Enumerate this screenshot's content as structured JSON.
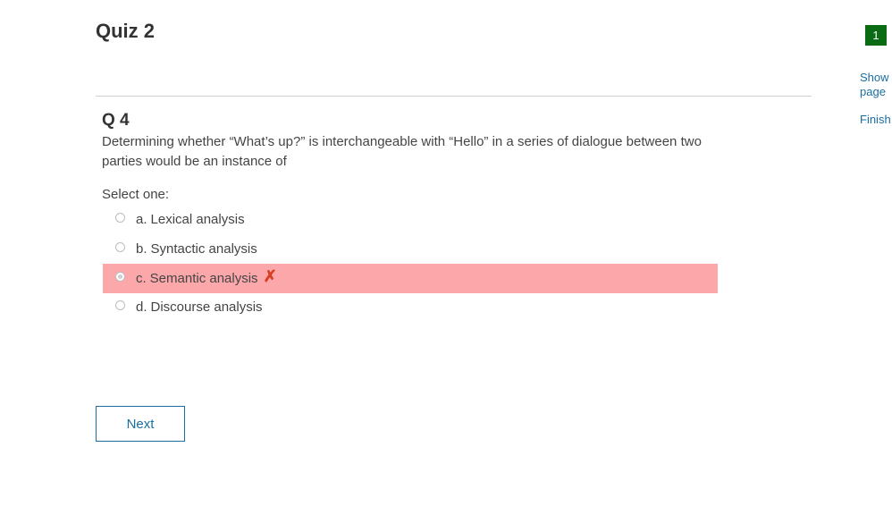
{
  "page": {
    "title": "Quiz 2"
  },
  "question": {
    "number": "Q 4",
    "text": "Determining whether “What’s up?” is interchangeable with “Hello” in a series of dialogue between two parties would be an instance of",
    "prompt": "Select one:",
    "options": [
      {
        "letter": "a.",
        "label": "Lexical analysis",
        "selected": false,
        "state": "neutral"
      },
      {
        "letter": "b.",
        "label": "Syntactic analysis",
        "selected": false,
        "state": "neutral"
      },
      {
        "letter": "c.",
        "label": "Semantic analysis",
        "selected": true,
        "state": "incorrect",
        "mark": "✗"
      },
      {
        "letter": "d.",
        "label": "Discourse analysis",
        "selected": false,
        "state": "neutral"
      }
    ]
  },
  "navigation": {
    "next_label": "Next"
  },
  "quiz_nav": {
    "current_page_badge": "1",
    "show_page_line1": "Show",
    "show_page_line2": "page",
    "finish_label": "Finish"
  },
  "colors": {
    "incorrect_bg": "#fca8ab",
    "incorrect_mark": "#d73d22",
    "link": "#1a6ea1",
    "badge_bg": "#0b6b12"
  },
  "icons": {
    "incorrect_mark": "x-mark-icon"
  }
}
